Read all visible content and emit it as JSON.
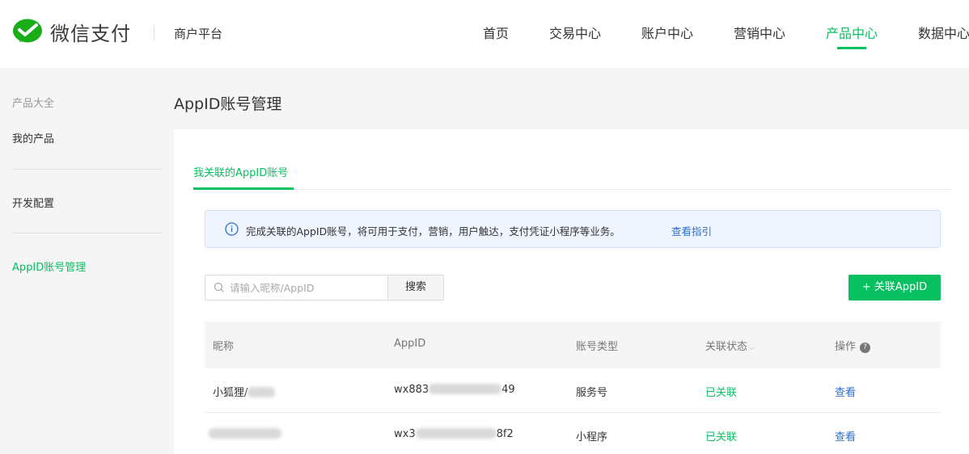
{
  "header": {
    "brand": "微信支付",
    "subtitle": "商户平台",
    "nav": [
      "首页",
      "交易中心",
      "账户中心",
      "营销中心",
      "产品中心",
      "数据中心"
    ],
    "active_nav": "产品中心",
    "accent_color": "#07c160"
  },
  "sidebar": {
    "items": [
      "产品大全",
      "我的产品",
      "开发配置",
      "AppID账号管理"
    ]
  },
  "page": {
    "title": "AppID账号管理",
    "tab": "我关联的AppID账号"
  },
  "notice": {
    "icon": "info-icon",
    "text": "完成关联的AppID账号，将可用于支付，营销，用户触达，支付凭证小程序等业务。",
    "link": "查看指引"
  },
  "search": {
    "placeholder": "请输入昵称/AppID",
    "value": "",
    "button": "搜索"
  },
  "add_button": "+ 关联AppID",
  "table": {
    "headers": [
      "昵称",
      "AppID",
      "账号类型",
      "关联状态",
      "操作"
    ],
    "rows": [
      {
        "nickname": "小狐狸/",
        "appid_prefix": "wx883",
        "appid_suffix": "49",
        "type": "服务号",
        "status": "已关联",
        "action": "查看"
      },
      {
        "nickname": "",
        "appid_prefix": "wx3",
        "appid_suffix": "8f2",
        "type": "小程序",
        "status": "已关联",
        "action": "查看"
      }
    ]
  }
}
